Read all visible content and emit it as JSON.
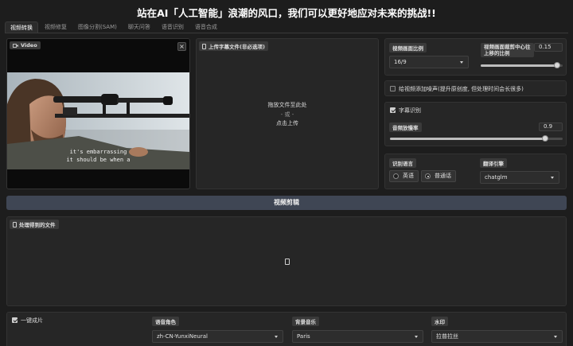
{
  "page_title": "站在AI「人工智能」浪潮的风口，我们可以更好地应对未来的挑战!!",
  "tabs": [
    "视频转换",
    "视频修复",
    "图像分割(SAM)",
    "聊天问答",
    "语音识别",
    "语音合成"
  ],
  "active_tab": 0,
  "video": {
    "label": "Video",
    "subtitle_line1": "it's embarrassing",
    "subtitle_line2": "it should be when a",
    "close_symbol": "×"
  },
  "upload": {
    "label": "上传字幕文件(非必选项)",
    "drop_text": "拖放文件至此处",
    "or_text": "- 或 -",
    "click_text": "点击上传"
  },
  "aspect": {
    "label": "视频画面比例",
    "value": "16/9"
  },
  "crop_center": {
    "label_line1": "视频画面裁剪中心往",
    "label_line2": "上移的比例",
    "value": "0.15",
    "fraction": 0.93
  },
  "noise": {
    "label": "给视频添加噪声(提升原创度, 但处理时间会长很多)",
    "checked": false
  },
  "subtitle_recognition": {
    "label": "字幕识别",
    "checked": true
  },
  "volume": {
    "label": "音频放慢率",
    "value": "0.9",
    "fraction": 0.9
  },
  "recog_lang": {
    "label": "识别语言",
    "options": [
      "英语",
      "普通话"
    ],
    "selected": 1
  },
  "translator": {
    "label": "翻译引擎",
    "value": "chatglm"
  },
  "clip_button": "视频剪辑",
  "output": {
    "label": "处理得到的文件"
  },
  "bottom": {
    "one_click_label": "一键成片",
    "one_click_checked": true,
    "voice": {
      "label": "语音角色",
      "value": "zh-CN-YunxiNeural"
    },
    "bgm": {
      "label": "背景音乐",
      "value": "Paris"
    },
    "watermark": {
      "label": "水印",
      "value": "拉普拉丝"
    }
  },
  "icon_names": [
    "video-icon",
    "close-icon",
    "file-icon",
    "chevron-down-icon"
  ]
}
